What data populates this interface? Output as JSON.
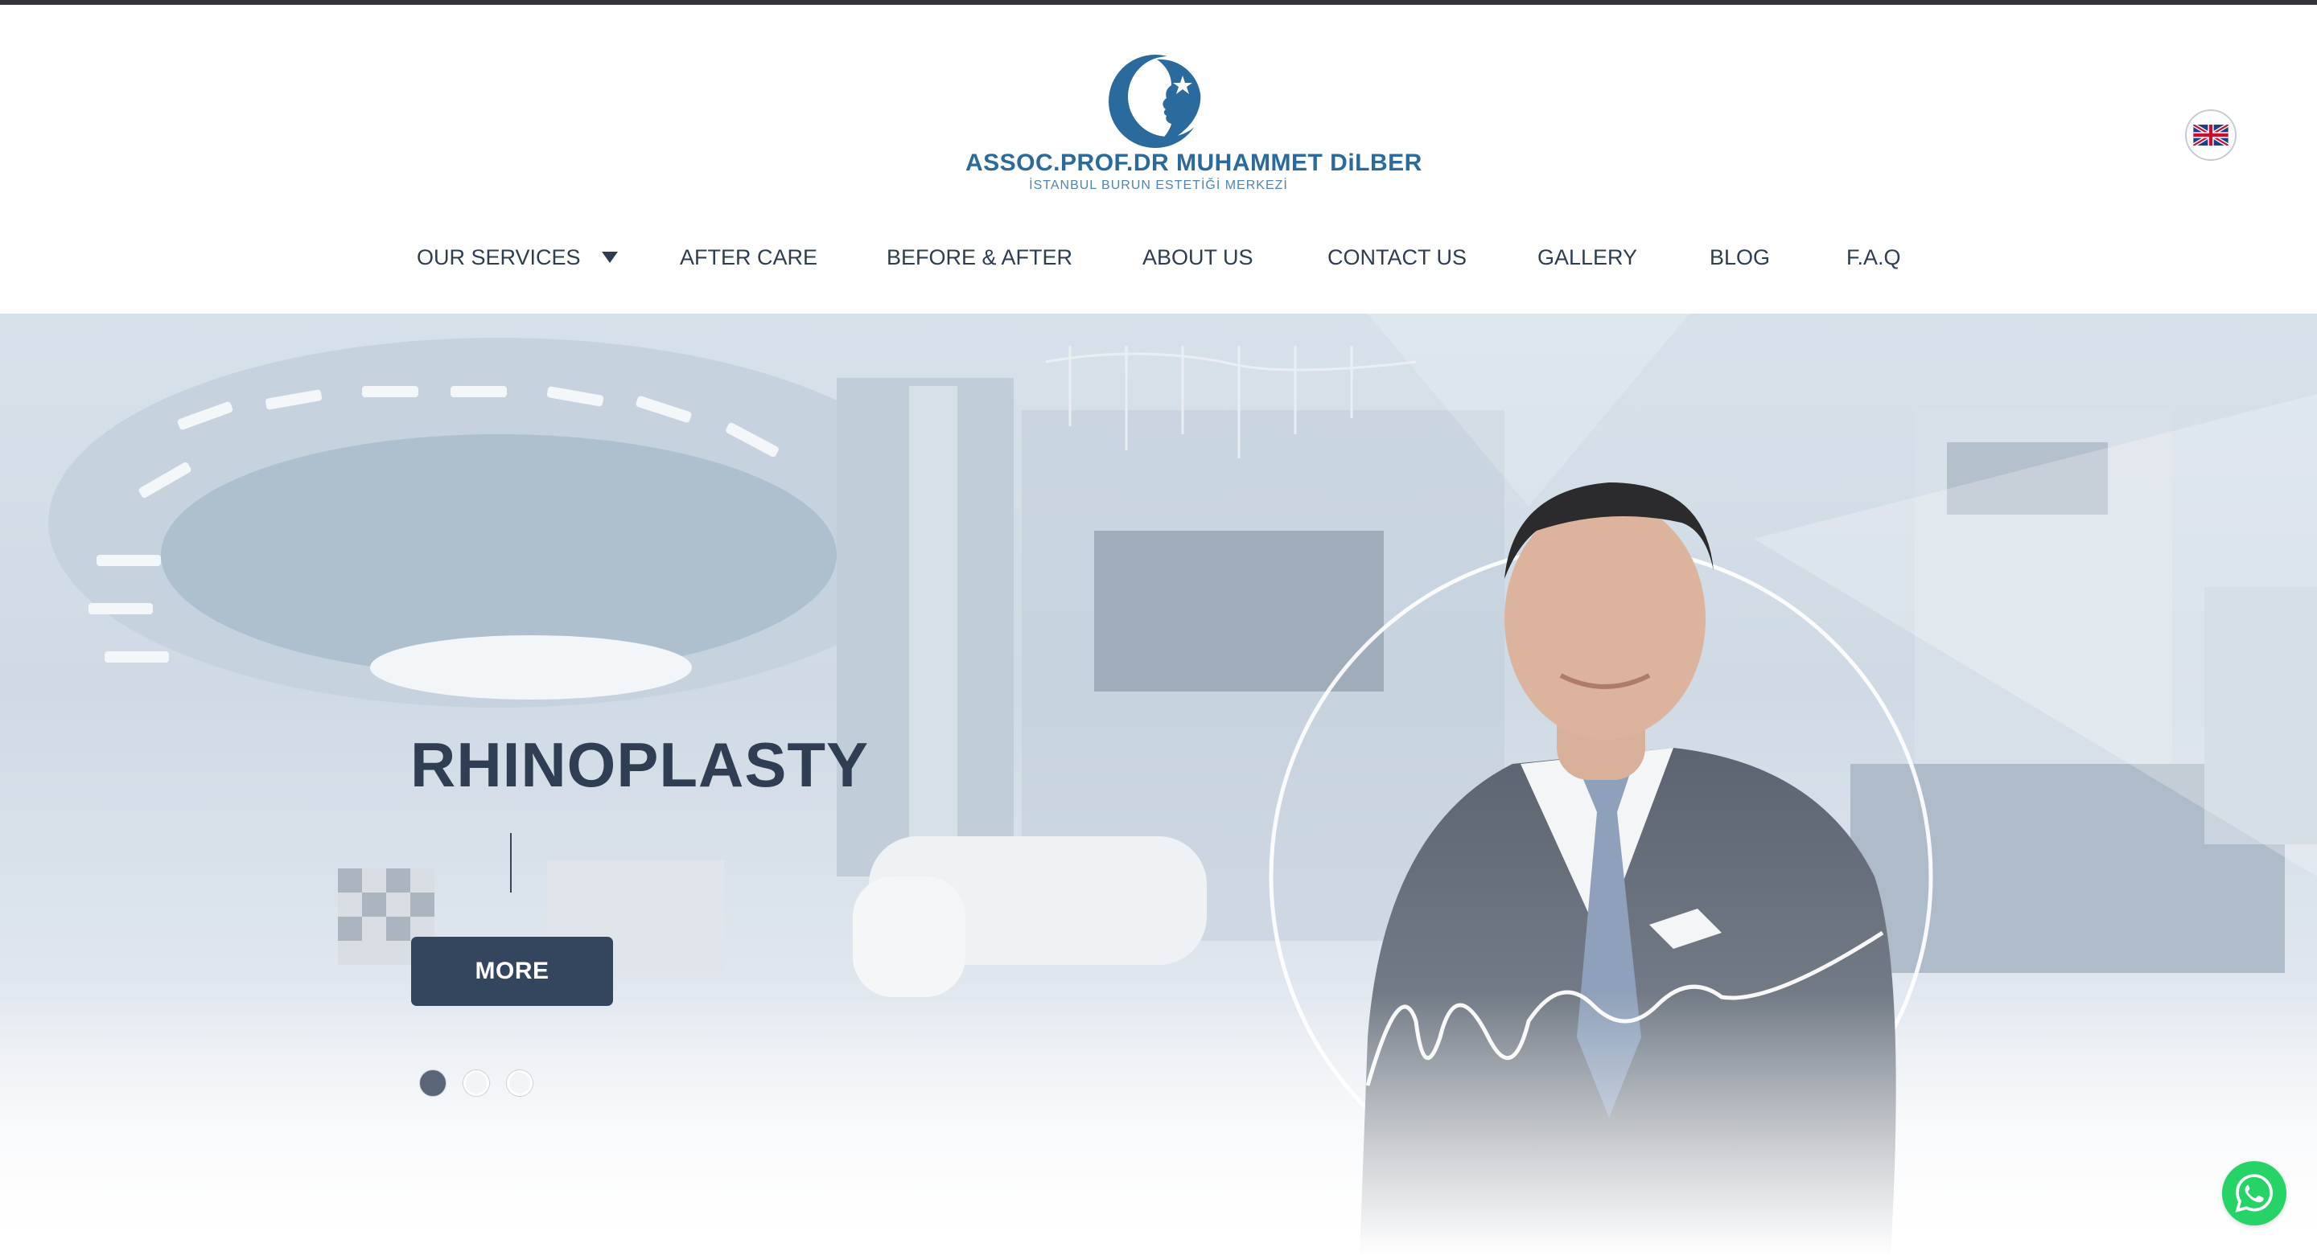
{
  "brand": {
    "name": "ASSOC.PROF.DR MUHAMMET DiLBER",
    "tagline": "İSTANBUL BURUN ESTETİĞİ MERKEZİ",
    "primary_color": "#2a6a9c",
    "dark_color": "#34465d"
  },
  "header": {
    "language": {
      "icon": "uk-flag-icon",
      "label": "English"
    }
  },
  "nav": {
    "items": [
      {
        "label": "OUR SERVICES",
        "has_dropdown": true
      },
      {
        "label": "AFTER CARE"
      },
      {
        "label": "BEFORE & AFTER"
      },
      {
        "label": "ABOUT US"
      },
      {
        "label": "CONTACT US"
      },
      {
        "label": "GALLERY"
      },
      {
        "label": "BLOG"
      },
      {
        "label": "F.A.Q"
      }
    ]
  },
  "hero": {
    "title": "RHINOPLASTY",
    "button_label": "MORE",
    "slides_total": 3,
    "active_slide": 1
  },
  "floating": {
    "whatsapp_icon": "whatsapp-icon",
    "whatsapp_color": "#25d366"
  }
}
